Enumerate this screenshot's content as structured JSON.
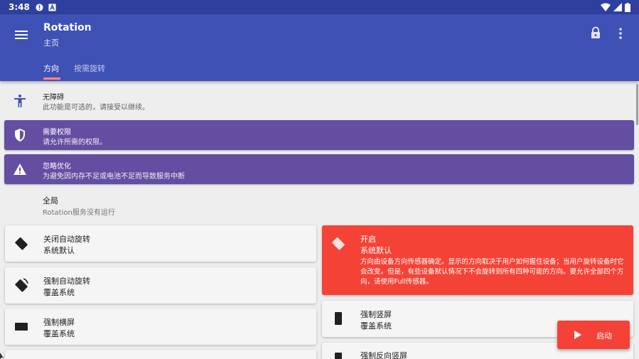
{
  "status_bar": {
    "time": "3:48",
    "icons_left": [
      "alert-circle-icon",
      "a-box-icon"
    ],
    "icons_right": [
      "wifi-icon",
      "signal-icon",
      "battery-icon"
    ]
  },
  "app_bar": {
    "title": "Rotation",
    "subtitle": "主页",
    "color": "#3f51b5",
    "tabs": [
      {
        "label": "方向",
        "active": true
      },
      {
        "label": "按需旋转",
        "active": false
      }
    ]
  },
  "rows": {
    "accessibility": {
      "icon": "accessibility-icon",
      "title": "无障碍",
      "subtitle": "此功能是可选的，请接受以继续。"
    },
    "permission": {
      "icon": "shield-icon",
      "title": "需要权限",
      "subtitle": "请允许所需的权限。",
      "color": "#644ea2"
    },
    "optimization": {
      "icon": "warning-icon",
      "title": "忽略优化",
      "subtitle": "为避免因内存不足或电池不足而导致服务中断",
      "color": "#644ea2"
    },
    "global": {
      "title": "全局",
      "subtitle": "Rotation服务没有运行"
    }
  },
  "modes_left": [
    {
      "icon": "rotate-off-icon",
      "title": "关闭自动旋转",
      "subtitle": "系统默认"
    },
    {
      "icon": "rotate-force-icon",
      "title": "强制自动旋转",
      "subtitle": "覆盖系统"
    },
    {
      "icon": "landscape-icon",
      "title": "强制横屏",
      "subtitle": "覆盖系统"
    }
  ],
  "modes_right": {
    "on": {
      "icon": "sensor-icon",
      "title": "开启",
      "subtitle": "系统默认",
      "description": "方向由设备方向传感器确定。显示的方向取决于用户如何握住设备；当用户旋转设备时它会改变。但是，有些设备默认情况下不会旋转到所有四种可能的方向。要允许全部四个方向，请使用Full传感器。",
      "color": "#f44336"
    },
    "portrait": {
      "icon": "portrait-icon",
      "title": "强制竖屏",
      "subtitle": "覆盖系统"
    },
    "reverse_portrait": {
      "icon": "reverse-portrait-icon",
      "title": "强制反向竖屏"
    }
  },
  "fab": {
    "icon": "play-icon",
    "label": "启动",
    "color": "#f44336"
  }
}
